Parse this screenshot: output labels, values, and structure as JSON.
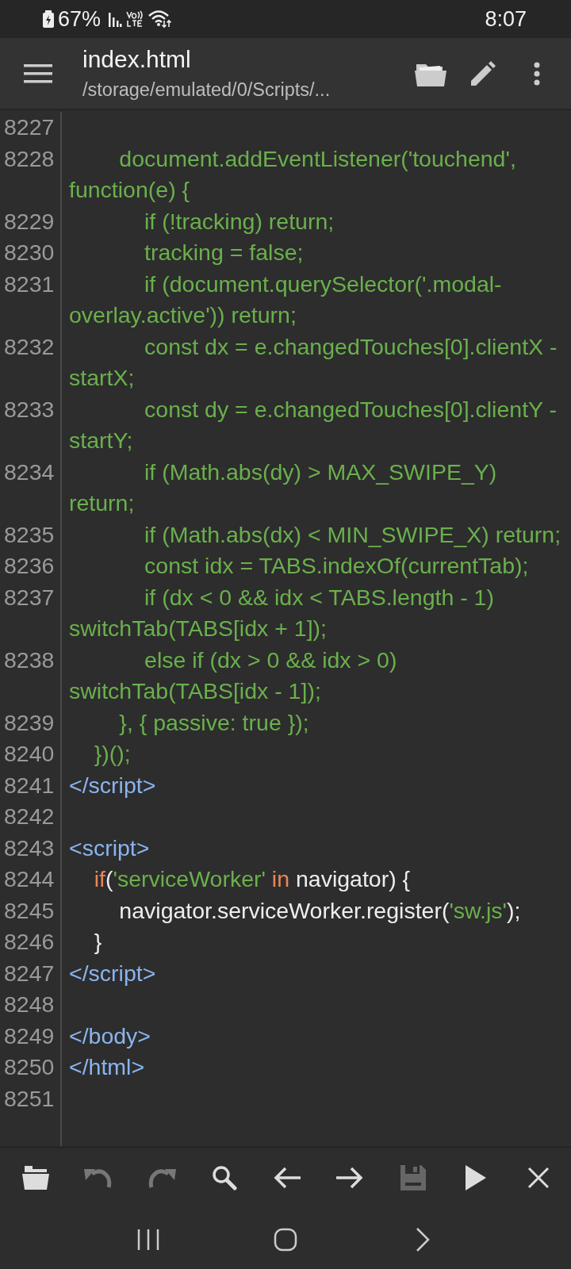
{
  "status_bar": {
    "battery": "67%",
    "time": "8:07"
  },
  "app_bar": {
    "title": "index.html",
    "path": "/storage/emulated/0/Scripts/..."
  },
  "editor": {
    "lines": [
      {
        "number": "8227"
      },
      {
        "number": "8228",
        "tokens": [
          {
            "kind": "code",
            "text": "        document.addEventListener('touchend', function(e) {"
          }
        ]
      },
      {
        "number": "8229",
        "tokens": [
          {
            "kind": "code",
            "text": "            if (!tracking) return;"
          }
        ]
      },
      {
        "number": "8230",
        "tokens": [
          {
            "kind": "code",
            "text": "            tracking = false;"
          }
        ]
      },
      {
        "number": "8231",
        "tokens": [
          {
            "kind": "code",
            "text": "            if (document.querySelector('.modal-overlay.active')) return;"
          }
        ]
      },
      {
        "number": "8232",
        "tokens": [
          {
            "kind": "code",
            "text": "            const dx = e.changedTouches[0].clientX - startX;"
          }
        ]
      },
      {
        "number": "8233",
        "tokens": [
          {
            "kind": "code",
            "text": "            const dy = e.changedTouches[0].clientY - startY;"
          }
        ]
      },
      {
        "number": "8234",
        "tokens": [
          {
            "kind": "code",
            "text": "            if (Math.abs(dy) > MAX_SWIPE_Y) return;"
          }
        ]
      },
      {
        "number": "8235",
        "tokens": [
          {
            "kind": "code",
            "text": "            if (Math.abs(dx) < MIN_SWIPE_X) return;"
          }
        ]
      },
      {
        "number": "8236",
        "tokens": [
          {
            "kind": "code",
            "text": "            const idx = TABS.indexOf(currentTab);"
          }
        ]
      },
      {
        "number": "8237",
        "tokens": [
          {
            "kind": "code",
            "text": "            if (dx < 0 && idx < TABS.length - 1) switchTab(TABS[idx + 1]);"
          }
        ]
      },
      {
        "number": "8238",
        "tokens": [
          {
            "kind": "code",
            "text": "            else if (dx > 0 && idx > 0) switchTab(TABS[idx - 1]);"
          }
        ]
      },
      {
        "number": "8239",
        "tokens": [
          {
            "kind": "code",
            "text": "        }, { passive: true });"
          }
        ]
      },
      {
        "number": "8240",
        "tokens": [
          {
            "kind": "code",
            "text": "    })();"
          }
        ]
      },
      {
        "number": "8241",
        "tokens": [
          {
            "kind": "tag",
            "text": "</script>"
          }
        ]
      },
      {
        "number": "8242"
      },
      {
        "number": "8243",
        "tokens": [
          {
            "kind": "tag",
            "text": "<script>"
          }
        ]
      },
      {
        "number": "8244",
        "tokens": [
          {
            "kind": "keyword",
            "text": "    if"
          },
          {
            "kind": "plain",
            "text": "("
          },
          {
            "kind": "code",
            "text": "'serviceWorker'"
          },
          {
            "kind": "keyword",
            "text": " in"
          },
          {
            "kind": "plain",
            "text": " navigator) {"
          }
        ]
      },
      {
        "number": "8245",
        "tokens": [
          {
            "kind": "plain",
            "text": "        navigator.serviceWorker.register("
          },
          {
            "kind": "code",
            "text": "'sw.js'"
          },
          {
            "kind": "plain",
            "text": ");"
          }
        ]
      },
      {
        "number": "8246",
        "tokens": [
          {
            "kind": "plain",
            "text": "    }"
          }
        ]
      },
      {
        "number": "8247",
        "tokens": [
          {
            "kind": "tag",
            "text": "</script>"
          }
        ]
      },
      {
        "number": "8248"
      },
      {
        "number": "8249",
        "tokens": [
          {
            "kind": "tag",
            "text": "</body>"
          }
        ]
      },
      {
        "number": "8250",
        "tokens": [
          {
            "kind": "tag",
            "text": "</html>"
          }
        ]
      },
      {
        "number": "8251"
      }
    ]
  }
}
